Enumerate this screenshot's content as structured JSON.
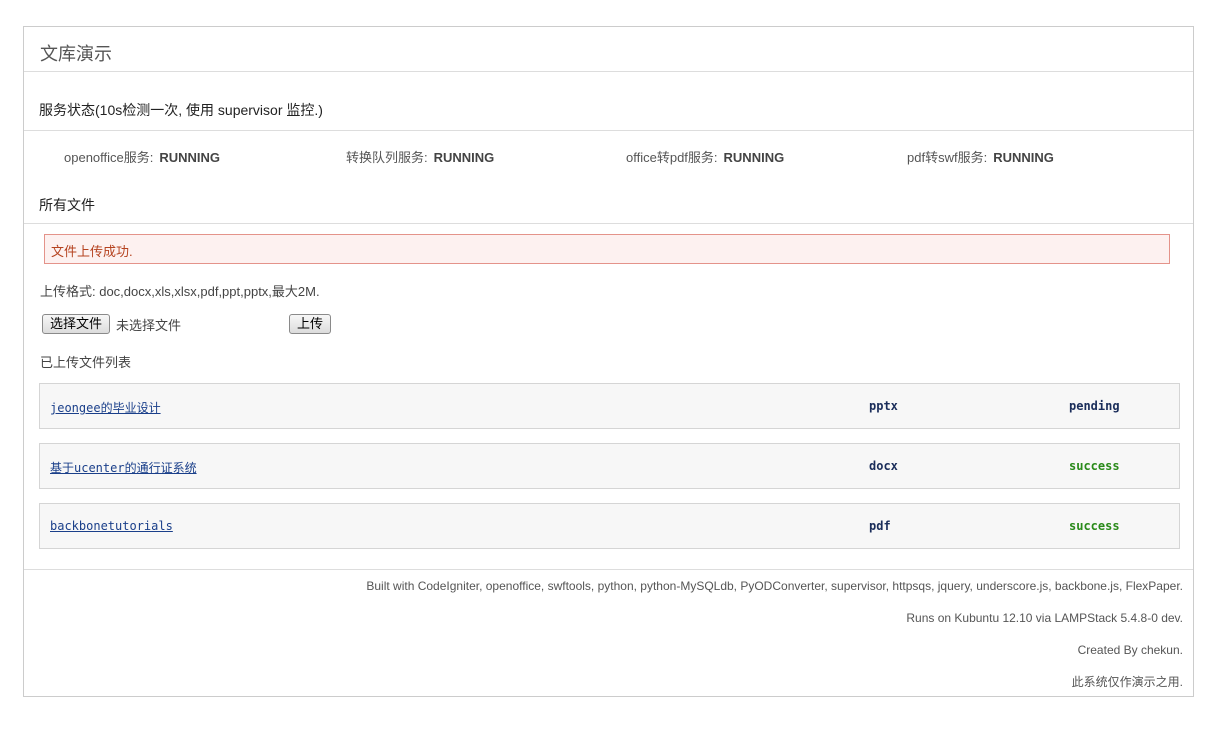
{
  "title": "文库演示",
  "service": {
    "heading": "服务状态(10s检测一次, 使用 supervisor 监控.)",
    "items": [
      {
        "label": "openoffice服务:",
        "value": "RUNNING"
      },
      {
        "label": "转换队列服务:",
        "value": "RUNNING"
      },
      {
        "label": "office转pdf服务:",
        "value": "RUNNING"
      },
      {
        "label": "pdf转swf服务:",
        "value": "RUNNING"
      }
    ]
  },
  "files": {
    "heading": "所有文件",
    "alert": "文件上传成功.",
    "upload_hint": "上传格式: doc,docx,xls,xlsx,pdf,ppt,pptx,最大2M.",
    "choose_button": "选择文件",
    "no_file_text": "未选择文件",
    "upload_button": "上传",
    "list_title": "已上传文件列表",
    "rows": [
      {
        "name": "jeongee的毕业设计",
        "type": "pptx",
        "status": "pending",
        "status_color": "#1a2d5a"
      },
      {
        "name": "基于ucenter的通行证系统",
        "type": "docx",
        "status": "success",
        "status_color": "#2a8a1a"
      },
      {
        "name": "backbonetutorials",
        "type": "pdf",
        "status": "success",
        "status_color": "#2a8a1a"
      }
    ]
  },
  "footer": {
    "lines": [
      "Built with CodeIgniter, openoffice, swftools, python, python-MySQLdb, PyODConverter, supervisor, httpsqs, jquery, underscore.js, backbone.js, FlexPaper.",
      "Runs on Kubuntu 12.10 via LAMPStack 5.4.8-0 dev.",
      "Created By chekun.",
      "此系统仅作演示之用."
    ]
  }
}
